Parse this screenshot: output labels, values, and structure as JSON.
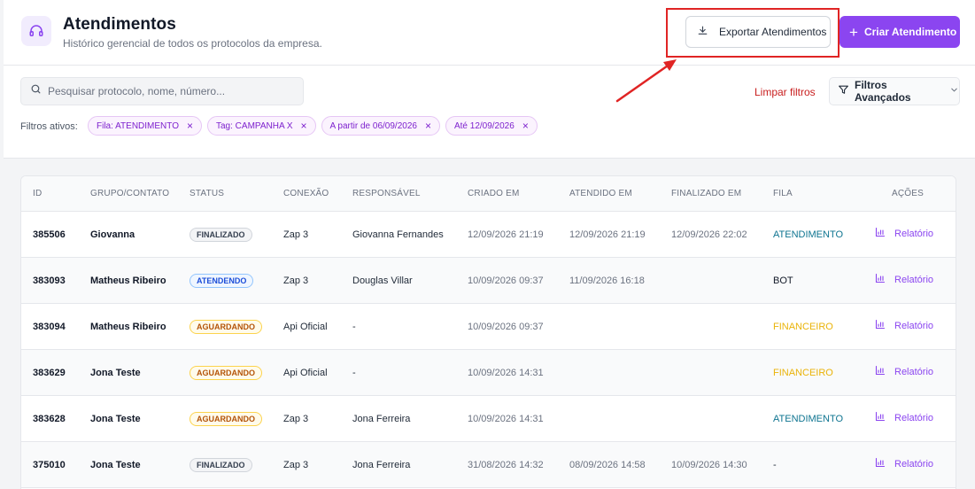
{
  "header": {
    "title": "Atendimentos",
    "subtitle": "Histórico gerencial de todos os protocolos da empresa.",
    "export_label": "Exportar Atendimentos",
    "create_label": "Criar Atendimento"
  },
  "filters": {
    "search_placeholder": "Pesquisar protocolo, nome, número...",
    "clear_label": "Limpar filtros",
    "advanced_label": "Filtros Avançados",
    "active_label": "Filtros ativos:",
    "chips": [
      {
        "label": "Fila: ATENDIMENTO"
      },
      {
        "label": "Tag: CAMPANHA X"
      },
      {
        "label": "A partir de 06/09/2026"
      },
      {
        "label": "Até 12/09/2026"
      }
    ]
  },
  "table": {
    "columns": [
      "ID",
      "GRUPO/CONTATO",
      "STATUS",
      "CONEXÃO",
      "RESPONSÁVEL",
      "CRIADO EM",
      "ATENDIDO EM",
      "FINALIZADO EM",
      "FILA",
      "AÇÕES"
    ],
    "action_label": "Relatório",
    "rows": [
      {
        "id": "385506",
        "contato": "Giovanna",
        "status": "FINALIZADO",
        "status_kind": "finalizado",
        "conexao": "Zap 3",
        "responsavel": "Giovanna Fernandes",
        "criado": "12/09/2026 21:19",
        "atendido": "12/09/2026 21:19",
        "finalizado": "12/09/2026 22:02",
        "fila": "ATENDIMENTO"
      },
      {
        "id": "383093",
        "contato": "Matheus Ribeiro",
        "status": "ATENDENDO",
        "status_kind": "atendendo",
        "conexao": "Zap 3",
        "responsavel": "Douglas Villar",
        "criado": "10/09/2026 09:37",
        "atendido": "11/09/2026 16:18",
        "finalizado": "",
        "fila": "BOT"
      },
      {
        "id": "383094",
        "contato": "Matheus Ribeiro",
        "status": "AGUARDANDO",
        "status_kind": "aguardando",
        "conexao": "Api Oficial",
        "responsavel": "-",
        "criado": "10/09/2026 09:37",
        "atendido": "",
        "finalizado": "",
        "fila": "FINANCEIRO"
      },
      {
        "id": "383629",
        "contato": "Jona Teste",
        "status": "AGUARDANDO",
        "status_kind": "aguardando",
        "conexao": "Api Oficial",
        "responsavel": "-",
        "criado": "10/09/2026 14:31",
        "atendido": "",
        "finalizado": "",
        "fila": "FINANCEIRO"
      },
      {
        "id": "383628",
        "contato": "Jona Teste",
        "status": "AGUARDANDO",
        "status_kind": "aguardando",
        "conexao": "Zap 3",
        "responsavel": "Jona Ferreira",
        "criado": "10/09/2026 14:31",
        "atendido": "",
        "finalizado": "",
        "fila": "ATENDIMENTO"
      },
      {
        "id": "375010",
        "contato": "Jona Teste",
        "status": "FINALIZADO",
        "status_kind": "finalizado",
        "conexao": "Zap 3",
        "responsavel": "Jona Ferreira",
        "criado": "31/08/2026 14:32",
        "atendido": "08/09/2026 14:58",
        "finalizado": "10/09/2026 14:30",
        "fila": "-"
      }
    ]
  },
  "colors": {
    "accent": "#8b45f0",
    "danger": "#c81e1e",
    "highlight": "#e02424"
  },
  "icons": {
    "header": "headset-icon",
    "export": "download-icon",
    "create": "plus-icon",
    "search": "search-icon",
    "advanced": "filter-icon",
    "chevron": "chevron-down-icon",
    "action": "bar-chart-icon"
  }
}
